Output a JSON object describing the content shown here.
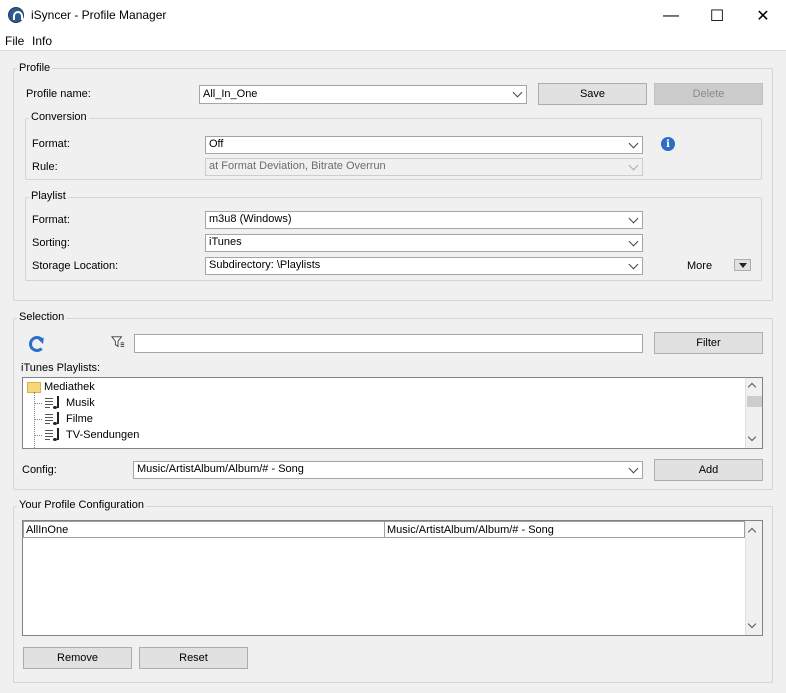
{
  "window": {
    "title": "iSyncer - Profile Manager",
    "minimize": "—",
    "maximize": "☐",
    "close": "✕"
  },
  "menu": {
    "file": "File",
    "info": "Info"
  },
  "profile": {
    "group_label": "Profile",
    "name_label": "Profile name:",
    "name_value": "All_In_One",
    "save_button": "Save",
    "delete_button": "Delete",
    "conversion": {
      "group_label": "Conversion",
      "format_label": "Format:",
      "format_value": "Off",
      "rule_label": "Rule:",
      "rule_value": "at Format Deviation, Bitrate Overrun"
    },
    "playlist": {
      "group_label": "Playlist",
      "format_label": "Format:",
      "format_value": "m3u8 (Windows)",
      "sorting_label": "Sorting:",
      "sorting_value": "iTunes",
      "storage_label": "Storage Location:",
      "storage_value": "Subdirectory: \\Playlists",
      "more_label": "More"
    }
  },
  "selection": {
    "group_label": "Selection",
    "filter_value": "",
    "filter_button": "Filter",
    "playlists_label": "iTunes Playlists:",
    "tree": {
      "root": "Mediathek",
      "children": [
        "Musik",
        "Filme",
        "TV-Sendungen"
      ]
    },
    "config_label": "Config:",
    "config_value": "Music/ArtistAlbum/Album/# - Song",
    "add_button": "Add"
  },
  "your_config": {
    "group_label": "Your Profile Configuration",
    "rows": [
      {
        "name": "AllInOne",
        "path": "Music/ArtistAlbum/Album/# - Song"
      }
    ],
    "remove_button": "Remove",
    "reset_button": "Reset"
  },
  "icons": {
    "app": "isyncer-headphones-icon",
    "info": "info-icon",
    "refresh": "refresh-icon",
    "filter": "funnel-icon"
  },
  "colors": {
    "accent": "#2b6cc4",
    "titlebar": "#ffffff",
    "window": "#f0f0f0"
  }
}
